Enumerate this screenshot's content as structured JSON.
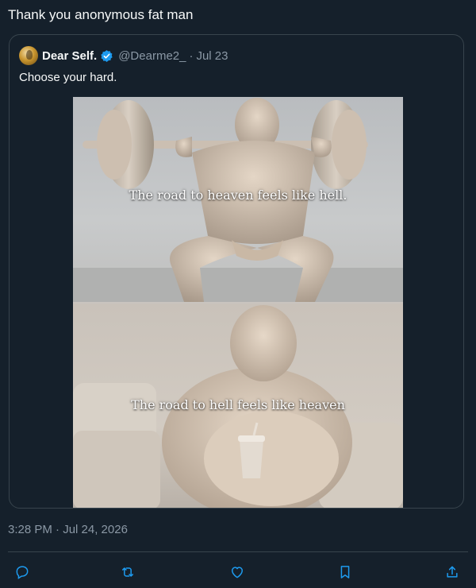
{
  "tweet": {
    "text": "Thank you anonymous fat man",
    "timestamp": "3:28 PM · Jul 24, 2026"
  },
  "quote": {
    "display_name": "Dear Self.",
    "handle": "@Dearme2_",
    "separator": "·",
    "date": "Jul 23",
    "text": "Choose your hard.",
    "meme_top_caption": "The road to heaven feels like hell.",
    "meme_bottom_caption": "The road to hell feels like heaven"
  },
  "colors": {
    "background": "#15202b",
    "text": "#f7f9f9",
    "secondary_text": "#8b98a5",
    "border": "#38444d",
    "verified_blue": "#1d9bf0"
  },
  "actions": [
    {
      "icon": "reply-icon"
    },
    {
      "icon": "retweet-icon"
    },
    {
      "icon": "like-icon"
    },
    {
      "icon": "bookmark-icon"
    },
    {
      "icon": "share-icon"
    }
  ]
}
